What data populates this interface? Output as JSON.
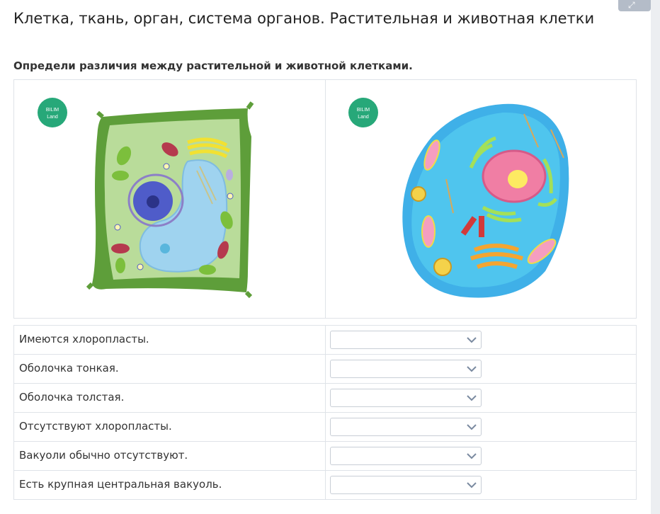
{
  "page": {
    "title": "Клетка, ткань, орган, система органов. Растительная и животная клетки",
    "instruction": "Определи различия между растительной и животной клетками."
  },
  "images": {
    "plant_cell": {
      "logo_line1": "BILIM",
      "logo_line2": "Land",
      "logo_color": "#27a879"
    },
    "animal_cell": {
      "logo_line1": "BILIM",
      "logo_line2": "Land",
      "logo_color": "#27a879"
    }
  },
  "questions": [
    {
      "text": "Имеются хлоропласты.",
      "selected": ""
    },
    {
      "text": "Оболочка тонкая.",
      "selected": ""
    },
    {
      "text": "Оболочка толстая.",
      "selected": ""
    },
    {
      "text": "Отсутствуют хлоропласты.",
      "selected": ""
    },
    {
      "text": "Вакуоли обычно отсутствуют.",
      "selected": ""
    },
    {
      "text": "Есть крупная центральная вакуоль.",
      "selected": ""
    }
  ],
  "icons": {
    "dropdown": "chevron-down-icon",
    "corner": "expand-icon"
  }
}
